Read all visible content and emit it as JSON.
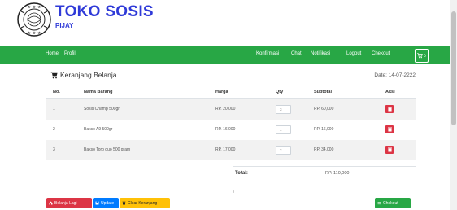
{
  "brand": {
    "title": "TOKO SOSIS",
    "subtitle": "PIJAY"
  },
  "nav": {
    "left": [
      "Home",
      "Profil"
    ],
    "right": [
      "Konfirmasi",
      "Chat",
      "Notifikasi",
      "Logout",
      "Chekout"
    ],
    "cart_count": "0"
  },
  "card": {
    "title": "Keranjang Belanja",
    "date": "Date: 14-07-2222"
  },
  "table": {
    "headers": [
      "No.",
      "Nama Barang",
      "Harga",
      "Qty",
      "Subtotal",
      "Aksi"
    ],
    "rows": [
      {
        "no": "1",
        "name": "Sosis Champ 500gr",
        "price": "RP. 20,000",
        "qty": "3",
        "subtotal": "RP. 60,000"
      },
      {
        "no": "2",
        "name": "Bakso A9 500gr",
        "price": "RP. 16,000",
        "qty": "1",
        "subtotal": "RP. 16,000"
      },
      {
        "no": "3",
        "name": "Bakso Toro duo 500 gram",
        "price": "RP. 17,000",
        "qty": "2",
        "subtotal": "RP. 34,000"
      }
    ]
  },
  "total": {
    "label": "Total:",
    "value": "RP. 110,000"
  },
  "buttons": {
    "continue": "Belanja Lagi",
    "update": "Update",
    "clear": "Clear Keranjang",
    "checkout": "Chekout"
  },
  "colors": {
    "brand_blue": "#2f3ad8",
    "navbar_green": "#28a745",
    "danger_red": "#dc3545",
    "primary_blue": "#007bff",
    "warning_yellow": "#ffc107"
  }
}
